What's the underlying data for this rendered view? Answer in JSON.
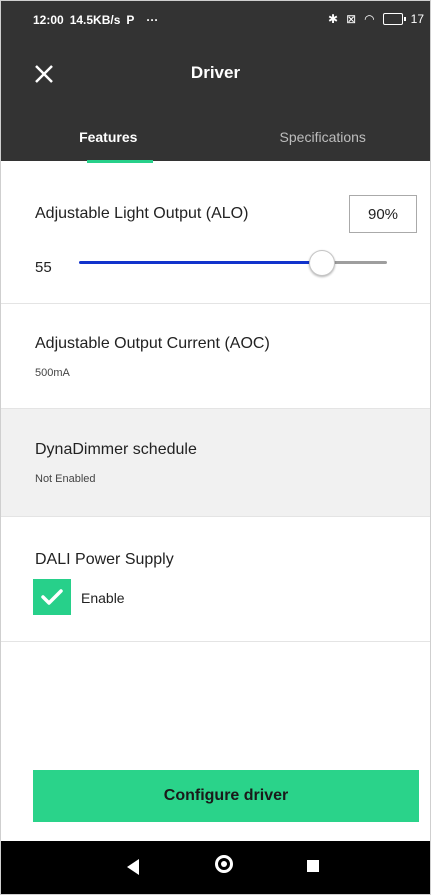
{
  "status_bar": {
    "time": "12:00",
    "speed": "14.5KB/s",
    "p_icon": "P",
    "more": "···",
    "battery": "17"
  },
  "header": {
    "title": "Driver",
    "tabs": [
      {
        "label": "Features",
        "active": true
      },
      {
        "label": "Specifications",
        "active": false
      }
    ]
  },
  "alo": {
    "label": "Adjustable Light Output (ALO)",
    "value": "90%",
    "min_label": "55",
    "slider_fraction": 0.8
  },
  "aoc": {
    "label": "Adjustable Output Current (AOC)",
    "value": "500mA"
  },
  "dynadimmer": {
    "label": "DynaDimmer schedule",
    "value": "Not Enabled"
  },
  "dali": {
    "label": "DALI Power Supply",
    "checkbox_label": "Enable",
    "checked": true
  },
  "cta": {
    "label": "Configure driver"
  },
  "colors": {
    "accent": "#2ad38a",
    "header_bg": "#333333",
    "slider_active": "#1133cc"
  },
  "icons": {
    "close": "close-icon",
    "check": "check-icon",
    "back": "back-icon",
    "home": "home-icon",
    "recents": "recents-icon"
  }
}
